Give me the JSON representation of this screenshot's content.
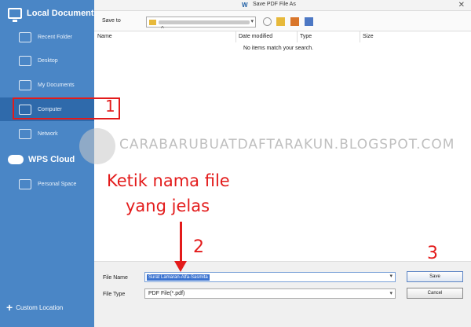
{
  "sidebar": {
    "local_title": "Local Document",
    "items": [
      "Recent Folder",
      "Desktop",
      "My Documents",
      "Computer",
      "Network"
    ],
    "cloud_title": "WPS Cloud",
    "cloud_items": [
      "Personal Space"
    ],
    "bottom_button": "Custom Location",
    "active": "Computer"
  },
  "window": {
    "title": "Save PDF File As"
  },
  "toolbar": {
    "save_to_label": "Save to"
  },
  "file_list": {
    "columns": [
      "Name",
      "Date modified",
      "Type",
      "Size"
    ],
    "empty_message": "No items match your search."
  },
  "form": {
    "file_name_label": "File Name",
    "file_name_value": "Surat Lamaran-Alfa-Sasmita",
    "file_type_label": "File Type",
    "file_type_value": "PDF File(*.pdf)",
    "save_button": "Save",
    "cancel_button": "Cancel"
  },
  "annotations": {
    "step1": "1",
    "step2": "2",
    "step3": "3",
    "instruction_line1": "Ketik nama file",
    "instruction_line2": "yang jelas"
  },
  "watermark": {
    "text": "CARABARUBUATDAFTARAKUN.BLOGSPOT.COM"
  },
  "colors": {
    "sidebar": "#4a86c6",
    "sidebar_active": "#2f6aab",
    "annotation": "#e31b1b"
  }
}
